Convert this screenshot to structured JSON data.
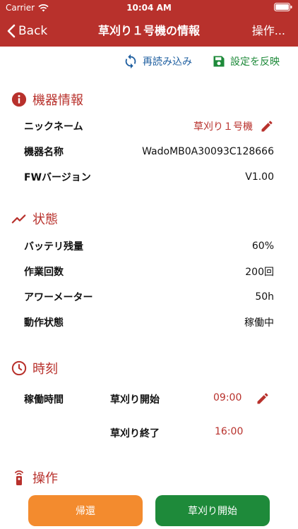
{
  "status_bar": {
    "carrier": "Carrier",
    "time": "10:04 AM"
  },
  "nav": {
    "back_label": "Back",
    "title": "草刈り１号機の情報",
    "operations_label": "操作..."
  },
  "toolbar": {
    "reload_label": "再読み込み",
    "apply_label": "設定を反映"
  },
  "device_info": {
    "header": "機器情報",
    "nickname_label": "ニックネーム",
    "nickname_value": "草刈り１号機",
    "device_name_label": "機器名称",
    "device_name_value": "WadoMB0A30093C128666",
    "fw_label": "FWバージョン",
    "fw_value": "V1.00"
  },
  "status": {
    "header": "状態",
    "battery_label": "バッテリ残量",
    "battery_value": "60%",
    "work_count_label": "作業回数",
    "work_count_value": "200回",
    "hour_meter_label": "アワーメーター",
    "hour_meter_value": "50h",
    "operation_state_label": "動作状態",
    "operation_state_value": "稼働中"
  },
  "time_section": {
    "header": "時刻",
    "operating_time_label": "稼働時間",
    "start_label": "草刈り開始",
    "start_time": "09:00",
    "end_label": "草刈り終了",
    "end_time": "16:00"
  },
  "operation": {
    "header": "操作",
    "return_button": "帰還",
    "start_button": "草刈り開始"
  },
  "colors": {
    "primary_red": "#b8312c",
    "reload_blue": "#1f5fa0",
    "apply_green": "#1e8a3a",
    "return_orange": "#f38b2e"
  }
}
